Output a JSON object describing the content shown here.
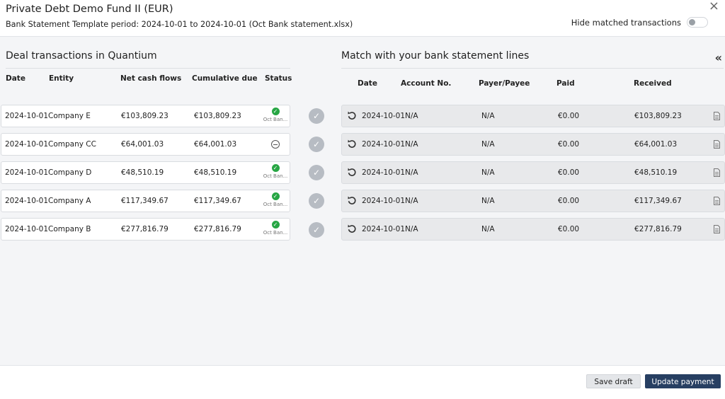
{
  "header": {
    "title": "Private Debt Demo Fund II (EUR)",
    "subtitle": "Bank Statement Template period: 2024-10-01 to 2024-10-01 (Oct Bank statement.xlsx)",
    "close_label": "×",
    "hide_matched_label": "Hide matched transactions",
    "hide_matched_on": false
  },
  "deals": {
    "title": "Deal transactions in Quantium",
    "columns": {
      "date": "Date",
      "entity": "Entity",
      "net": "Net cash flows",
      "cumulative": "Cumulative due",
      "status": "Status"
    },
    "rows": [
      {
        "date": "2024-10-01",
        "entity": "Company E",
        "net": "€103,809.23",
        "cumulative": "€103,809.23",
        "status": "matched",
        "status_text": "Oct Ban..."
      },
      {
        "date": "2024-10-01",
        "entity": "Company CC",
        "net": "€64,001.03",
        "cumulative": "€64,001.03",
        "status": "unmatched",
        "status_text": ""
      },
      {
        "date": "2024-10-01",
        "entity": "Company D",
        "net": "€48,510.19",
        "cumulative": "€48,510.19",
        "status": "matched",
        "status_text": "Oct Ban..."
      },
      {
        "date": "2024-10-01",
        "entity": "Company A",
        "net": "€117,349.67",
        "cumulative": "€117,349.67",
        "status": "matched",
        "status_text": "Oct Ban..."
      },
      {
        "date": "2024-10-01",
        "entity": "Company B",
        "net": "€277,816.79",
        "cumulative": "€277,816.79",
        "status": "matched",
        "status_text": "Oct Ban..."
      }
    ]
  },
  "bank": {
    "title": "Match with your bank statement lines",
    "collapse_label": "«",
    "columns": {
      "date": "Date",
      "account": "Account No.",
      "payer": "Payer/Payee",
      "paid": "Paid",
      "received": "Received"
    },
    "rows": [
      {
        "date": "2024-10-01",
        "account": "N/A",
        "payer": "N/A",
        "paid": "€0.00",
        "received": "€103,809.23"
      },
      {
        "date": "2024-10-01",
        "account": "N/A",
        "payer": "N/A",
        "paid": "€0.00",
        "received": "€64,001.03"
      },
      {
        "date": "2024-10-01",
        "account": "N/A",
        "payer": "N/A",
        "paid": "€0.00",
        "received": "€48,510.19"
      },
      {
        "date": "2024-10-01",
        "account": "N/A",
        "payer": "N/A",
        "paid": "€0.00",
        "received": "€117,349.67"
      },
      {
        "date": "2024-10-01",
        "account": "N/A",
        "payer": "N/A",
        "paid": "€0.00",
        "received": "€277,816.79"
      }
    ]
  },
  "icons": {
    "match": "check-circle-icon",
    "undo": "undo-icon",
    "document": "document-icon",
    "status_matched": "check-icon",
    "status_unmatched": "minus-circle-icon"
  },
  "colors": {
    "primary": "#273f62",
    "success": "#27a644",
    "match_button": "#b7bcc3"
  },
  "footer": {
    "save_draft_label": "Save draft",
    "update_payment_label": "Update payment"
  }
}
